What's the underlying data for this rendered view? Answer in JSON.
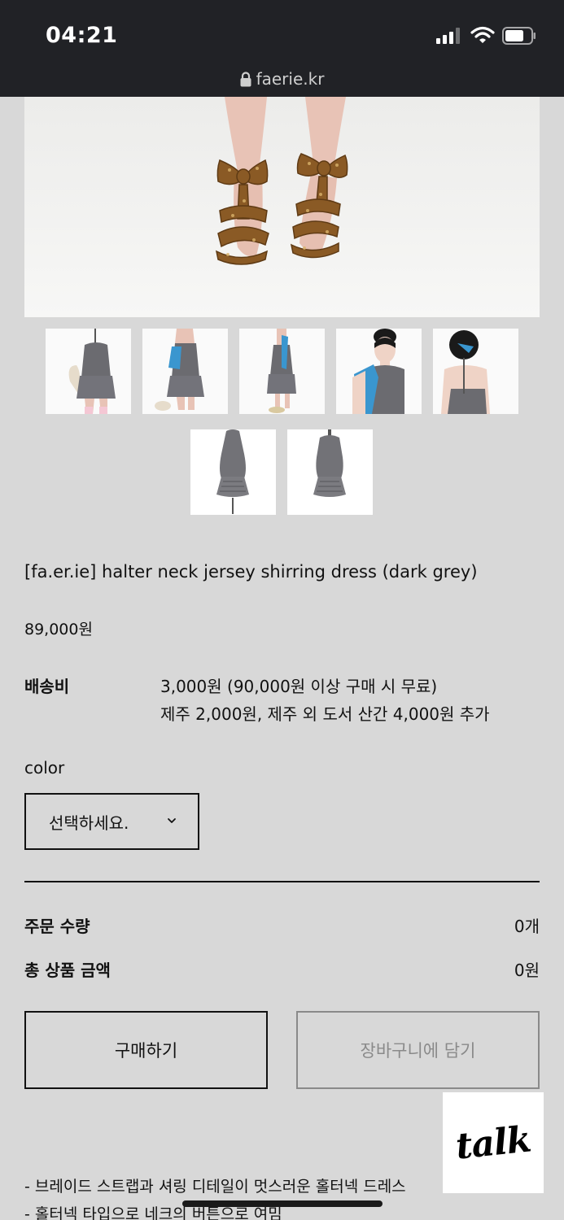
{
  "status_bar": {
    "time": "04:21"
  },
  "browser": {
    "domain": "faerie.kr"
  },
  "product": {
    "title": "[fa.er.ie] halter neck jersey shirring dress (dark grey)",
    "price": "89,000원"
  },
  "shipping": {
    "label": "배송비",
    "line1": "3,000원 (90,000원 이상 구매 시 무료)",
    "line2": "제주 2,000원, 제주 외 도서 산간 4,000원 추가"
  },
  "options": {
    "color_label": "color",
    "color_select_value": "선택하세요."
  },
  "summary": {
    "quantity_label": "주문 수량",
    "quantity_value": "0개",
    "total_label": "총 상품 금액",
    "total_value": "0원"
  },
  "actions": {
    "buy_label": "구매하기",
    "cart_label": "장바구니에 담기",
    "talk_label": "talk"
  },
  "description": {
    "line1": "- 브레이드 스트랩과 셔링 디테일이 멋스러운 홀터넥 드레스",
    "line2": "- 홀터넥 타입으로 네크의 버튼으로 여밈"
  },
  "colors": {
    "page_bg": "#d8d8d8",
    "status_bar_bg": "#212226",
    "dress_grey": "#6b6b70",
    "scarf_blue": "#3a96cf"
  },
  "icons": [
    "lock-icon",
    "signal-icon",
    "wifi-icon",
    "battery-icon",
    "chevron-down-icon"
  ]
}
